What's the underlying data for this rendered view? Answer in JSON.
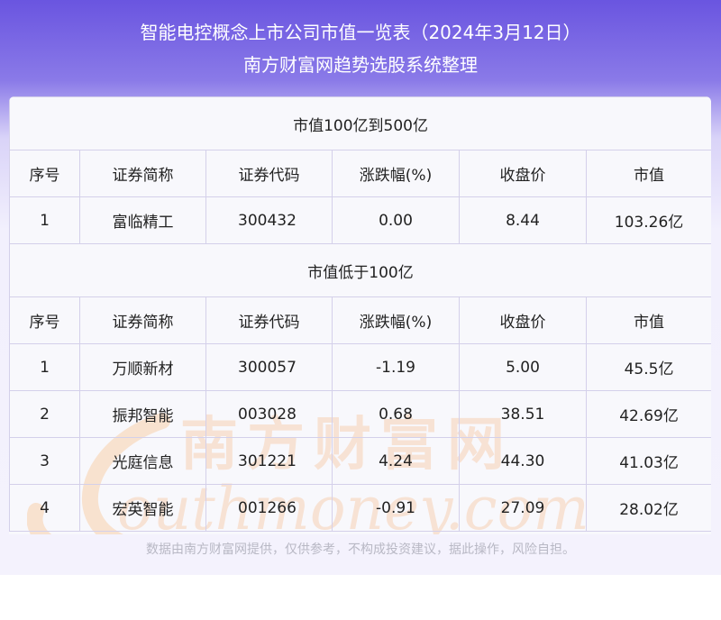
{
  "header": {
    "title": "智能电控概念上市公司市值一览表（2024年3月12日）",
    "subtitle": "南方财富网趋势选股系统整理"
  },
  "columns": [
    "序号",
    "证券简称",
    "证券代码",
    "涨跌幅(%)",
    "收盘价",
    "市值"
  ],
  "sections": [
    {
      "label": "市值100亿到500亿",
      "rows": [
        [
          "1",
          "富临精工",
          "300432",
          "0.00",
          "8.44",
          "103.26亿"
        ]
      ]
    },
    {
      "label": "市值低于100亿",
      "rows": [
        [
          "1",
          "万顺新材",
          "300057",
          "-1.19",
          "5.00",
          "45.5亿"
        ],
        [
          "2",
          "振邦智能",
          "003028",
          "0.68",
          "38.51",
          "42.69亿"
        ],
        [
          "3",
          "光庭信息",
          "301221",
          "4.24",
          "44.30",
          "41.03亿"
        ],
        [
          "4",
          "宏英智能",
          "001266",
          "-0.91",
          "27.09",
          "28.02亿"
        ]
      ]
    }
  ],
  "watermark": {
    "cn": "南方财富网",
    "en": "outhmoney.com",
    "color": "#f6c9a4"
  },
  "footer": "数据由南方财富网提供，仅供参考，不构成投资建议，据此操作，风险自担。"
}
